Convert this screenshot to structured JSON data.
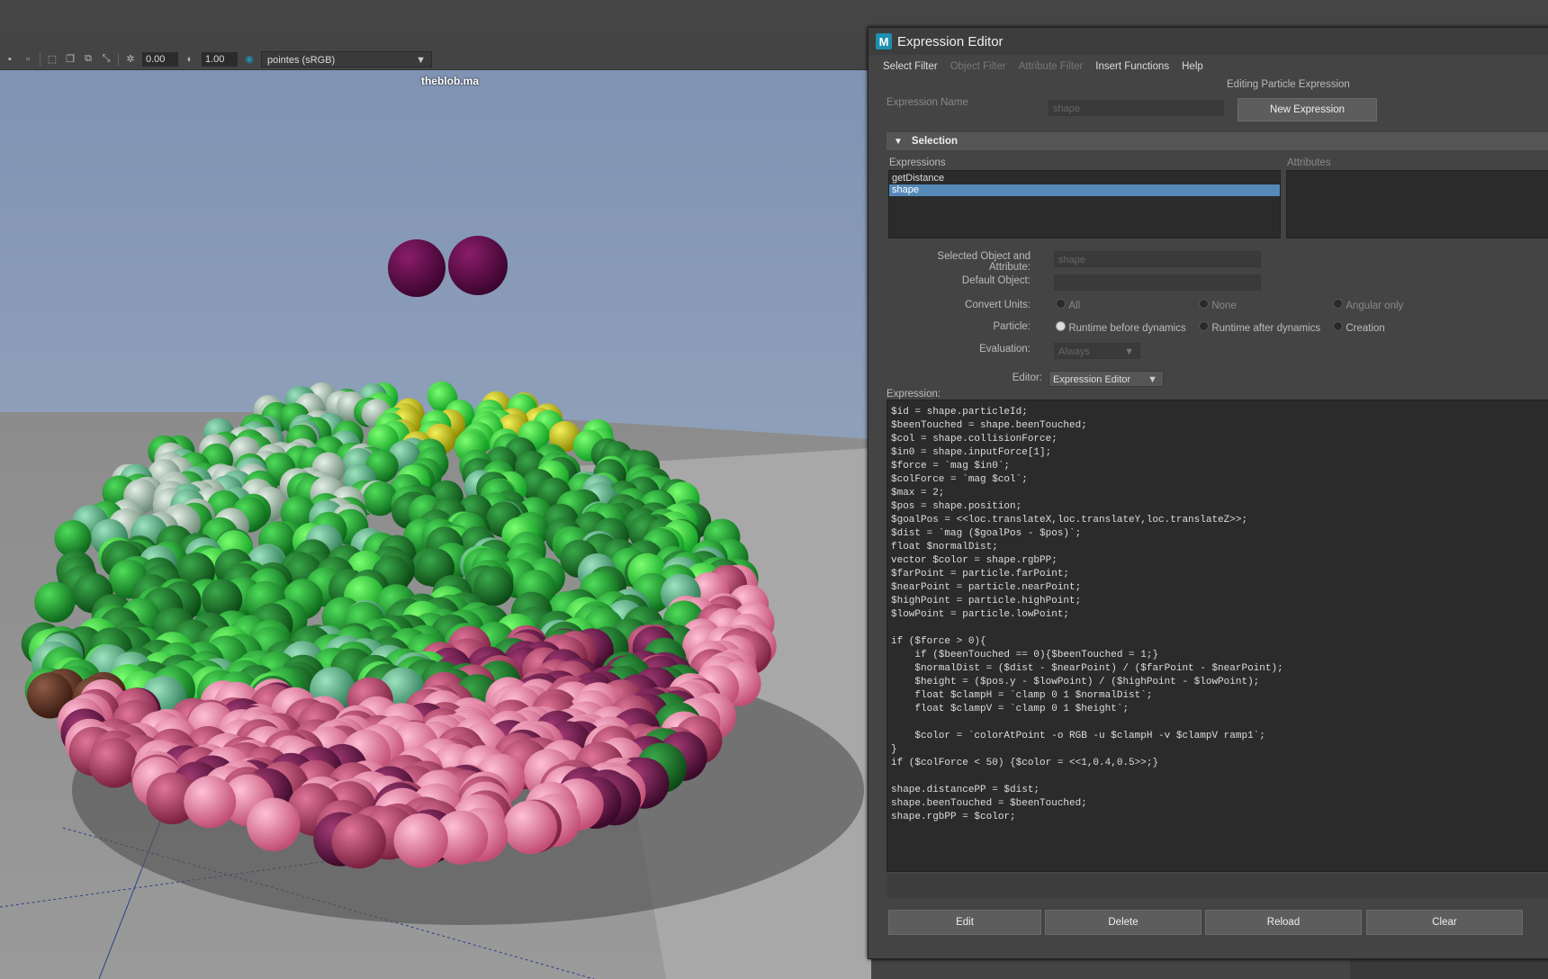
{
  "viewport": {
    "toolbar": {
      "exposure": "0.00",
      "gamma": "1.00",
      "colorspace": "pointes (sRGB)"
    },
    "title": "theblob.ma"
  },
  "dialog": {
    "title": "Expression Editor",
    "logo": "M",
    "menus": [
      "Select Filter",
      "Object Filter",
      "Attribute Filter",
      "Insert Functions",
      "Help"
    ],
    "mode_label": "Editing Particle Expression",
    "expression_name_label": "Expression Name",
    "expression_name_value": "shape",
    "new_expression_button": "New Expression",
    "selection_header": "Selection",
    "expressions_label": "Expressions",
    "attributes_label": "Attributes",
    "expressions": [
      "getDistance",
      "shape"
    ],
    "selected_expression": "shape",
    "selected_object_label": "Selected Object and Attribute:",
    "selected_object_value": "shape",
    "default_object_label": "Default Object:",
    "default_object_value": "",
    "convert_units_label": "Convert Units:",
    "convert_units_options": [
      "All",
      "None",
      "Angular only"
    ],
    "particle_label": "Particle:",
    "particle_options": [
      "Runtime before dynamics",
      "Runtime after dynamics",
      "Creation"
    ],
    "evaluation_label": "Evaluation:",
    "evaluation_value": "Always",
    "editor_label": "Editor:",
    "editor_value": "Expression Editor",
    "expression_label": "Expression:",
    "code_lines": [
      "$id = shape.particleId;",
      "$beenTouched = shape.beenTouched;",
      "$col = shape.collisionForce;",
      "$in0 = shape.inputForce[1];",
      "$force = `mag $in0`;",
      "$colForce = `mag $col`;",
      "$max = 2;",
      "$pos = shape.position;",
      "$goalPos = <<loc.translateX,loc.translateY,loc.translateZ>>;",
      "$dist = `mag ($goalPos - $pos)`;",
      "float $normalDist;",
      "vector $color = shape.rgbPP;",
      "$farPoint = particle.farPoint;",
      "$nearPoint = particle.nearPoint;",
      "$highPoint = particle.highPoint;",
      "$lowPoint = particle.lowPoint;",
      "",
      "if ($force > 0){",
      "    if ($beenTouched == 0){$beenTouched = 1;}",
      "    $normalDist = ($dist - $nearPoint) / ($farPoint - $nearPoint);",
      "    $height = ($pos.y - $lowPoint) / ($highPoint - $lowPoint);",
      "    float $clampH = `clamp 0 1 $normalDist`;",
      "    float $clampV = `clamp 0 1 $height`;",
      "",
      "    $color = `colorAtPoint -o RGB -u $clampH -v $clampV ramp1`;",
      "}",
      "if ($colForce < 50) {$color = <<1,0.4,0.5>>;}",
      "",
      "shape.distancePP = $dist;",
      "shape.beenTouched = $beenTouched;",
      "shape.rgbPP = $color;"
    ],
    "buttons": [
      "Edit",
      "Delete",
      "Reload",
      "Clear"
    ]
  }
}
